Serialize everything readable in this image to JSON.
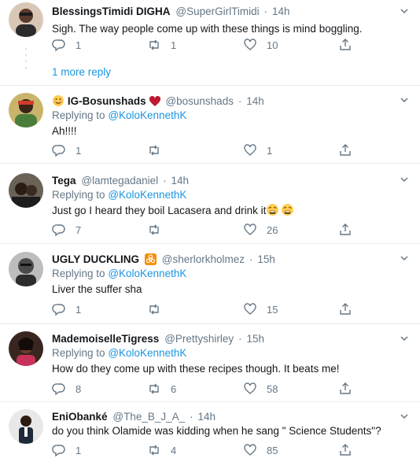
{
  "tweets": [
    {
      "name": "BlessingsTimidi DIGHA",
      "handle": "@SuperGirlTimidi",
      "time": "14h",
      "replying_prefix": "",
      "replying_to": "",
      "text": "Sigh. The way people come up with these things is mind boggling.",
      "replies": "1",
      "retweets": "1",
      "likes": "10"
    },
    {
      "name": "IG-Bosunshads",
      "handle": "@bosunshads",
      "time": "14h",
      "replying_prefix": "Replying to",
      "replying_to": "@KoloKennethK",
      "text": "Ah!!!!",
      "replies": "1",
      "retweets": "",
      "likes": "1"
    },
    {
      "name": "Tega",
      "handle": "@lamtegadaniel",
      "time": "14h",
      "replying_prefix": "Replying to",
      "replying_to": "@KoloKennethK",
      "text": "Just go I heard they boil Lacasera and drink it",
      "replies": "7",
      "retweets": "",
      "likes": "26"
    },
    {
      "name": "UGLY DUCKLING",
      "handle": "@sherlorkholmez",
      "time": "15h",
      "replying_prefix": "Replying to",
      "replying_to": "@KoloKennethK",
      "text": "Liver the suffer sha",
      "replies": "1",
      "retweets": "",
      "likes": "15"
    },
    {
      "name": "MademoiselleTigress",
      "handle": "@Prettyshirley",
      "time": "15h",
      "replying_prefix": "Replying to",
      "replying_to": "@KoloKennethK",
      "text": "How do they come up with these recipes though. It beats me!",
      "replies": "8",
      "retweets": "6",
      "likes": "58"
    },
    {
      "name": "EniObanké",
      "handle": "@The_B_J_A_",
      "time": "14h",
      "replying_prefix": "",
      "replying_to": "",
      "text": "do you think Olamide was kidding when he sang \" Science Students\"?",
      "replies": "1",
      "retweets": "4",
      "likes": "85"
    }
  ],
  "more_replies": "1 more reply",
  "colors": {
    "accent": "#1b95e0",
    "muted": "#657786",
    "divider": "#e6ecf0",
    "heart": "#e0245e"
  },
  "icons": [
    "reply-icon",
    "retweet-icon",
    "like-icon",
    "share-icon",
    "chevron-down-icon"
  ]
}
